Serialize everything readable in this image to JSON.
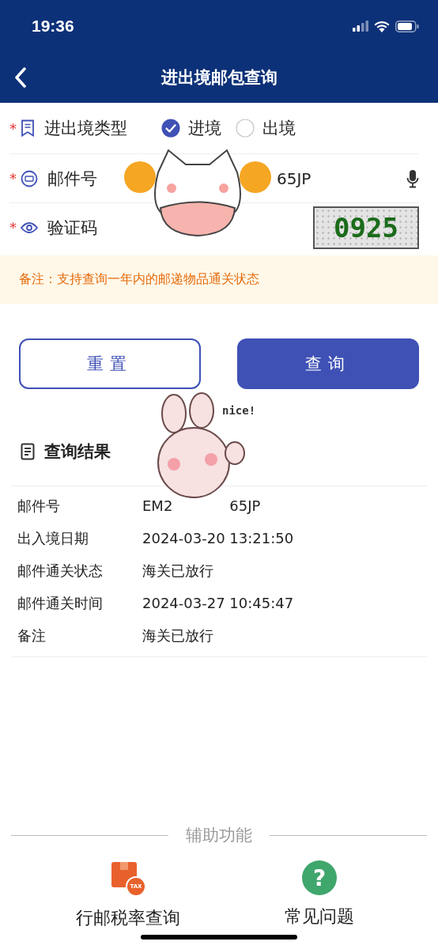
{
  "status_bar": {
    "time": "19:36"
  },
  "header": {
    "title": "进出境邮包查询"
  },
  "form": {
    "fields": [
      {
        "kind": "radio",
        "required_mark": "*",
        "label": "进出境类型",
        "options": [
          {
            "label": "进境",
            "selected": true
          },
          {
            "label": "出境",
            "selected": false
          }
        ]
      },
      {
        "kind": "text",
        "required_mark": "*",
        "label": "邮件号",
        "value": "65JP"
      },
      {
        "kind": "captcha",
        "required_mark": "*",
        "label": "验证码",
        "captcha": "0925"
      }
    ]
  },
  "notice": "备注：支持查询一年内的邮递物品通关状态",
  "buttons": [
    {
      "kind": "outline",
      "label": "重置"
    },
    {
      "kind": "primary",
      "label": "查询"
    }
  ],
  "result": {
    "title": "查询结果",
    "rows": [
      {
        "label": "邮件号",
        "values": [
          "EM2",
          "65JP"
        ]
      },
      {
        "label": "出入境日期",
        "values": [
          "2024-03-20 13:21:50"
        ]
      },
      {
        "label": "邮件通关状态",
        "values": [
          "海关已放行"
        ]
      },
      {
        "label": "邮件通关时间",
        "values": [
          "2024-03-27 10:45:47"
        ]
      },
      {
        "label": "备注",
        "values": [
          "海关已放行"
        ]
      }
    ]
  },
  "aux": {
    "title": "辅助功能",
    "items": [
      {
        "kind": "tax",
        "badge": "TAX",
        "label": "行邮税率查询"
      },
      {
        "kind": "help",
        "glyph": "?",
        "label": "常见问题"
      }
    ]
  },
  "stickers": [
    {
      "kind": "cat"
    },
    {
      "kind": "rabbit",
      "text": "nice!"
    }
  ]
}
